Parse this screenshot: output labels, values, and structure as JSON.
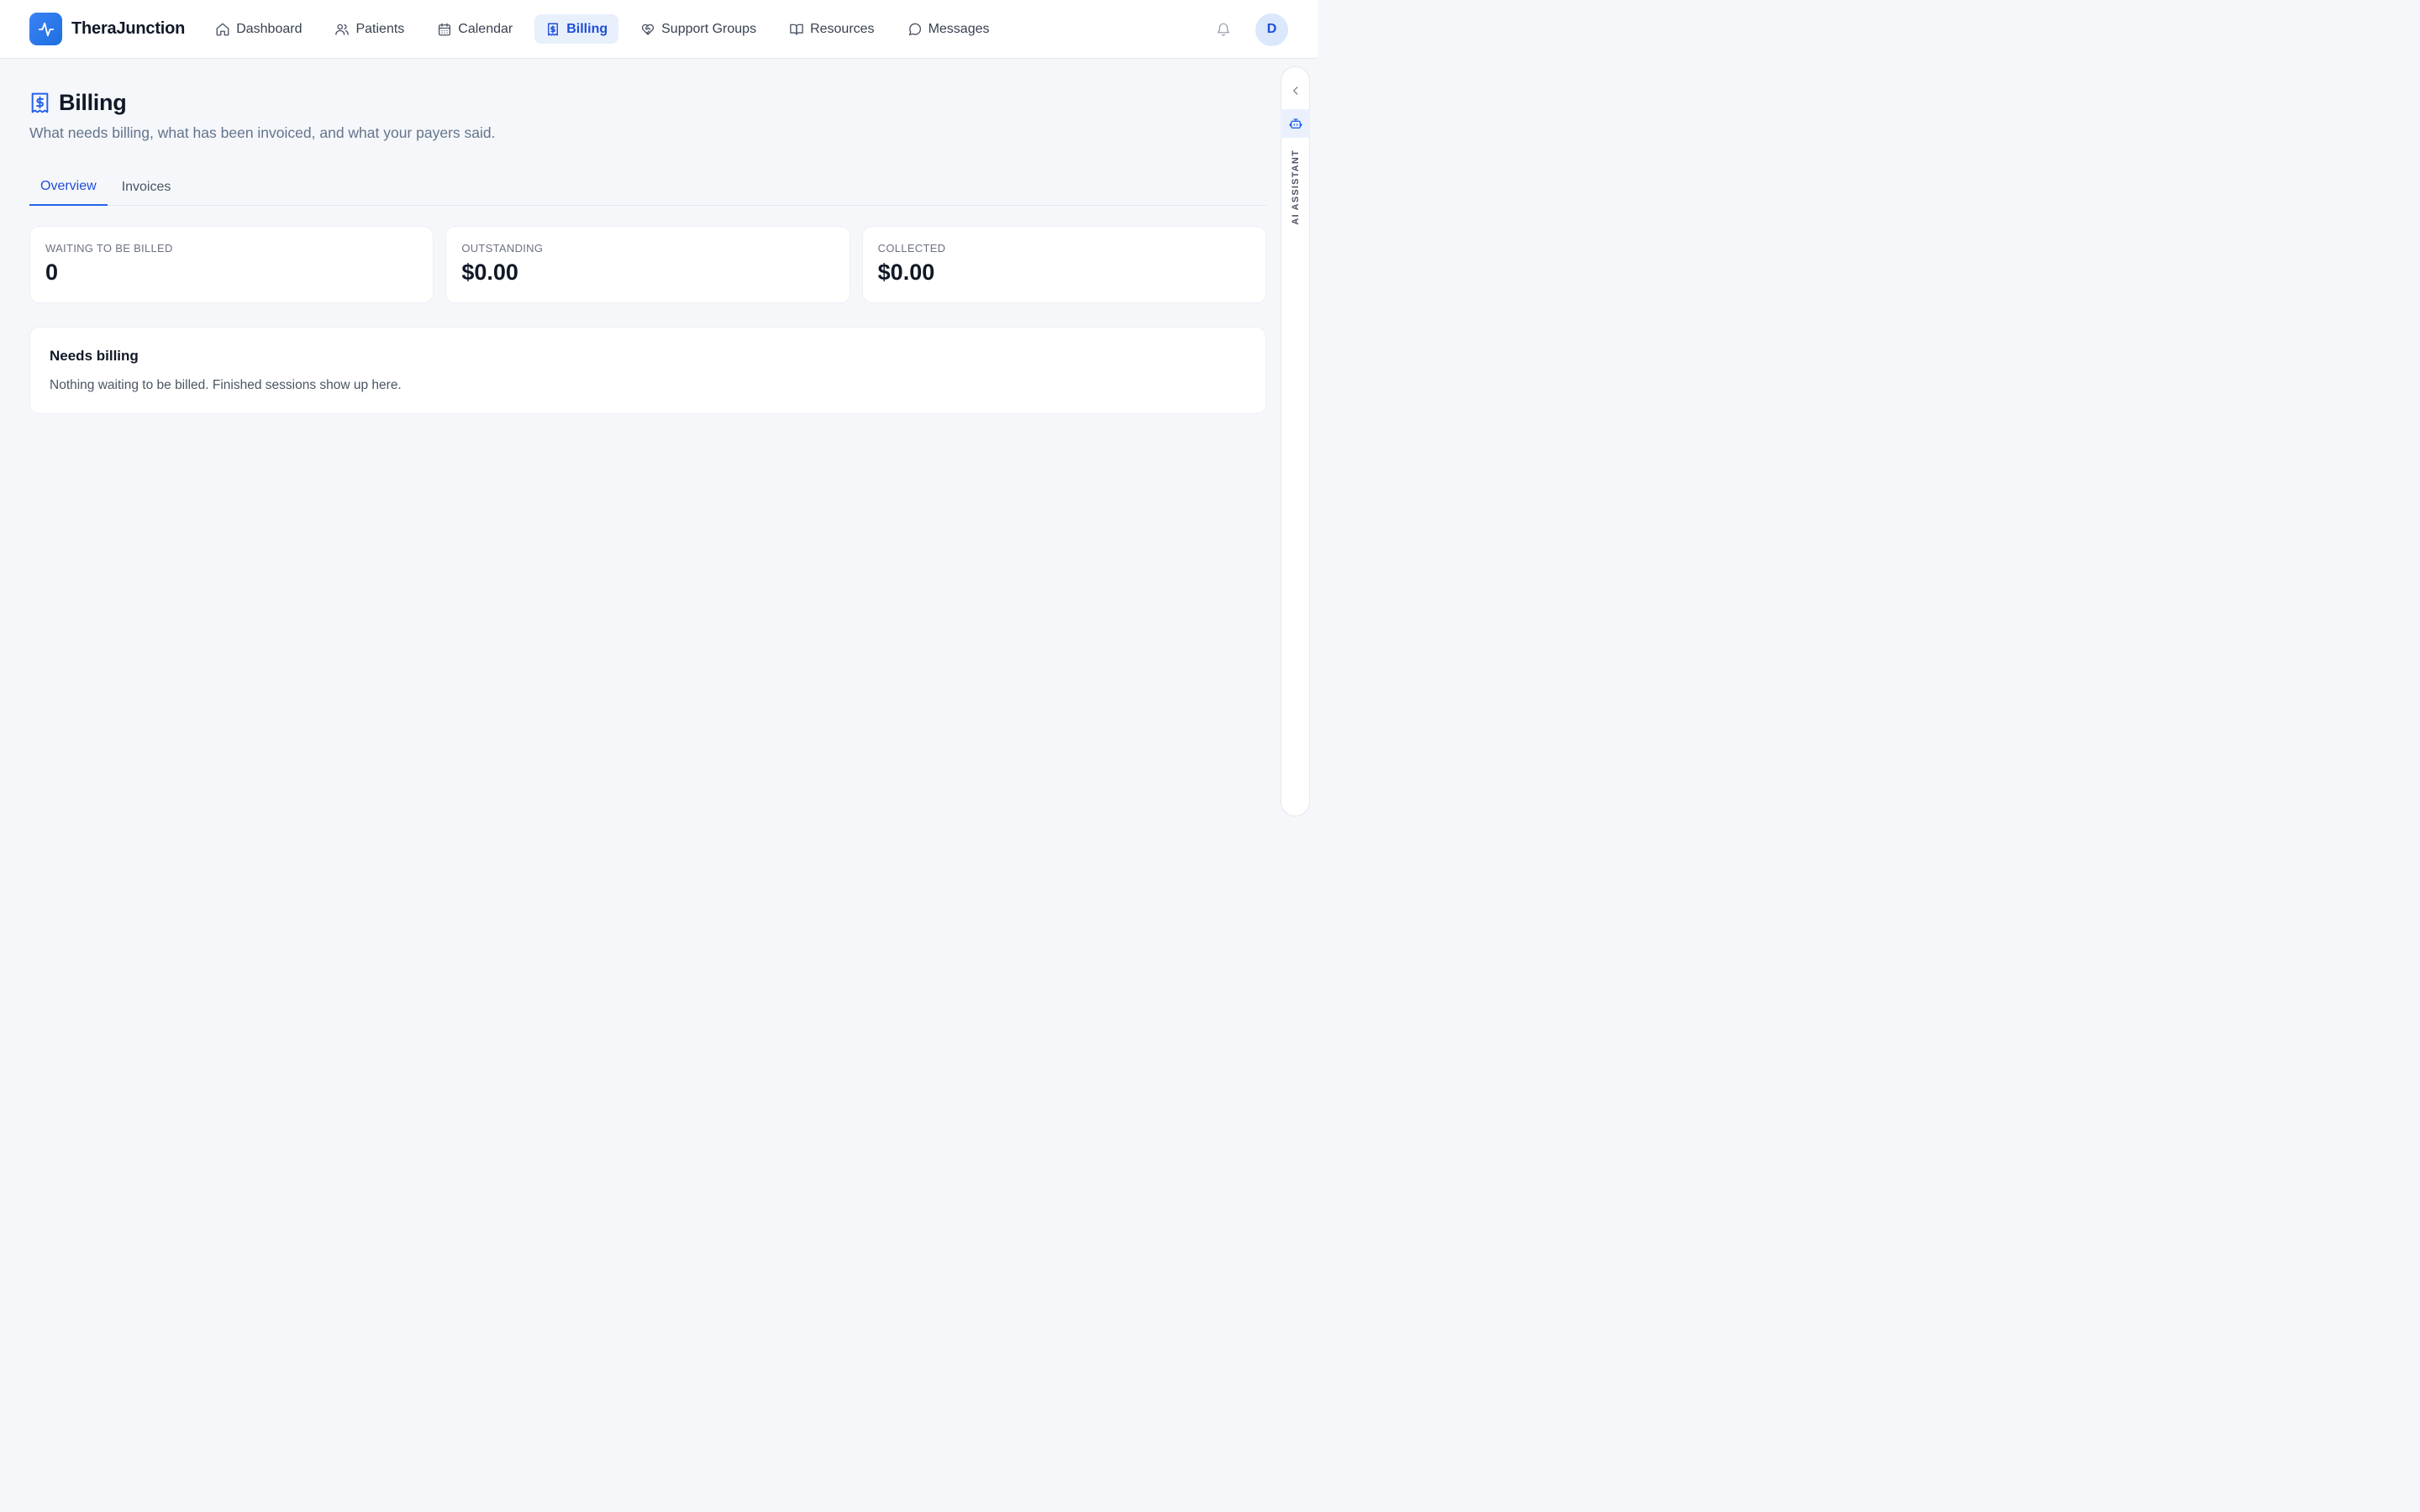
{
  "app": {
    "name": "TheraJunction"
  },
  "nav": {
    "items": [
      {
        "label": "Dashboard",
        "icon": "home-icon"
      },
      {
        "label": "Patients",
        "icon": "users-icon"
      },
      {
        "label": "Calendar",
        "icon": "calendar-icon"
      },
      {
        "label": "Billing",
        "icon": "receipt-icon",
        "active": true
      },
      {
        "label": "Support Groups",
        "icon": "heart-handshake-icon"
      },
      {
        "label": "Resources",
        "icon": "book-open-icon"
      },
      {
        "label": "Messages",
        "icon": "message-circle-icon"
      }
    ]
  },
  "user": {
    "avatar_initial": "D"
  },
  "page": {
    "title": "Billing",
    "subtitle": "What needs billing, what has been invoiced, and what your payers said."
  },
  "tabs": [
    {
      "label": "Overview",
      "active": true
    },
    {
      "label": "Invoices",
      "active": false
    }
  ],
  "stats": [
    {
      "label": "WAITING TO BE BILLED",
      "value": "0"
    },
    {
      "label": "OUTSTANDING",
      "value": "$0.00"
    },
    {
      "label": "COLLECTED",
      "value": "$0.00"
    }
  ],
  "needs_billing": {
    "title": "Needs billing",
    "empty_message": "Nothing waiting to be billed. Finished sessions show up here."
  },
  "assistant": {
    "label": "AI ASSISTANT"
  },
  "colors": {
    "accent": "#2563eb",
    "active_bg": "#e8f0fc",
    "page_bg": "#f5f7fa"
  }
}
